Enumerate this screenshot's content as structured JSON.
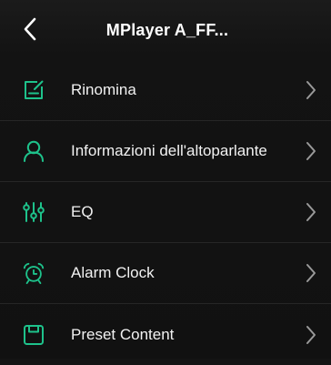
{
  "header": {
    "title": "MPlayer A_FF..."
  },
  "colors": {
    "accent": "#1ec28b",
    "background": "#141414",
    "text": "#ffffff",
    "chevron": "#9a9a9a"
  },
  "menu": {
    "items": [
      {
        "label": "Rinomina",
        "icon": "edit-icon"
      },
      {
        "label": "Informazioni dell'altoparlante",
        "icon": "user-icon"
      },
      {
        "label": "EQ",
        "icon": "equalizer-icon"
      },
      {
        "label": "Alarm Clock",
        "icon": "alarm-clock-icon"
      },
      {
        "label": "Preset Content",
        "icon": "preset-icon"
      }
    ]
  }
}
